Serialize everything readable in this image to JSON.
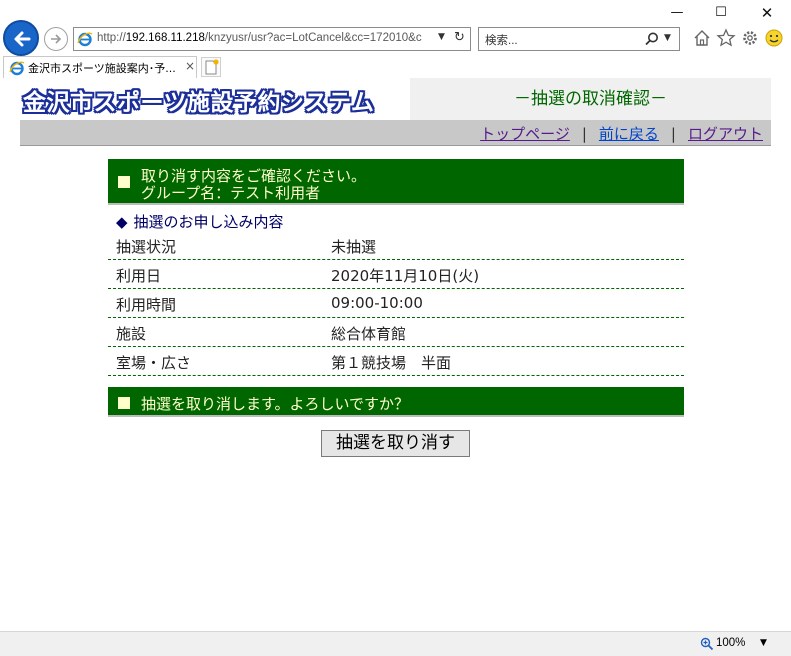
{
  "browser": {
    "window_controls": {
      "minimize": "—",
      "maximize": "☐",
      "close": "✕"
    },
    "address": {
      "url_prefix": "http://",
      "url_host": "192.168.11.218",
      "url_path": "/knzyusr/usr?ac=LotCancel&cc=172010&c"
    },
    "search": {
      "placeholder": "検索..."
    },
    "tab": {
      "title": "金沢市スポーツ施設案内･予...",
      "close": "×"
    },
    "status": {
      "zoom": "100%"
    },
    "accent": "#1a66c8"
  },
  "site": {
    "logo": "金沢市スポーツ施設予約システム",
    "page_heading": "－抽選の取消確認－",
    "nav": {
      "top": "トップページ",
      "back": "前に戻る",
      "logout": "ログアウト",
      "separator": "|"
    }
  },
  "confirm": {
    "line1": "取り消す内容をご確認ください。",
    "line2": "グループ名：テスト利用者"
  },
  "section": {
    "marker": "◆",
    "title": "抽選のお申し込み内容"
  },
  "details": [
    {
      "label": "抽選状況",
      "value": "未抽選"
    },
    {
      "label": "利用日",
      "value": "2020年11月10日(火)"
    },
    {
      "label": "利用時間",
      "value": "09:00-10:00"
    },
    {
      "label": "施設",
      "value": "総合体育館"
    },
    {
      "label": "室場・広さ",
      "value": "第１競技場　半面"
    }
  ],
  "question": "抽選を取り消します。よろしいですか？",
  "cancel_button": "抽選を取り消す",
  "colors": {
    "green_bar": "#006600",
    "bar_text": "#ffffcc",
    "navy": "#000066",
    "logo_blue": "#1c2f99"
  }
}
